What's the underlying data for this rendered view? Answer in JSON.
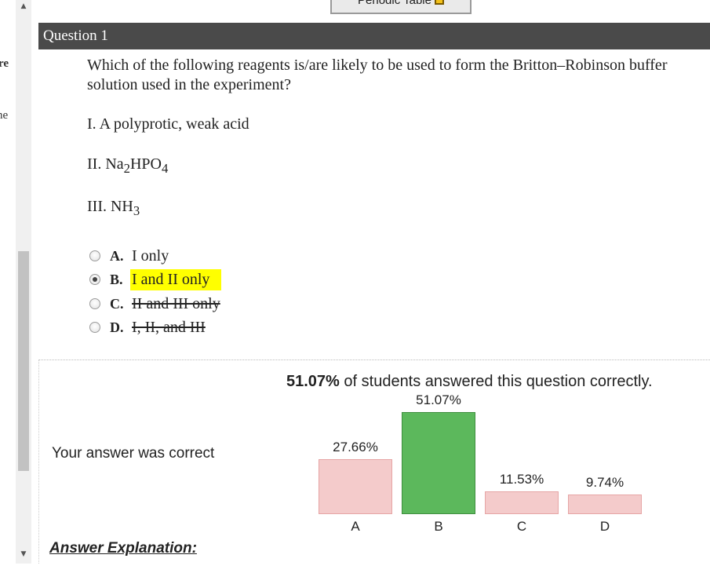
{
  "sidebar_fragments": [
    "re",
    "ne"
  ],
  "toolbar": {
    "periodic_table_label": "Periodic Table"
  },
  "question": {
    "header": "Question 1",
    "text": "Which of the following reagents is/are likely to be used to form the Britton–Robinson buffer solution used in the experiment?",
    "statements": [
      {
        "numeral": "I.",
        "text": "A polyprotic, weak acid"
      },
      {
        "numeral": "II.",
        "text": "Na",
        "sub1": "2",
        "mid": "HPO",
        "sub2": "4"
      },
      {
        "numeral": "III.",
        "text": "NH",
        "sub1": "3"
      }
    ],
    "choices": [
      {
        "letter": "A.",
        "text": "I only",
        "selected": false,
        "struck": false,
        "highlighted": false
      },
      {
        "letter": "B.",
        "text": "I and II only",
        "selected": true,
        "struck": false,
        "highlighted": true
      },
      {
        "letter": "C.",
        "text": "II and III only",
        "selected": false,
        "struck": true,
        "highlighted": false
      },
      {
        "letter": "D.",
        "text": "I, II, and III",
        "selected": false,
        "struck": true,
        "highlighted": false
      }
    ]
  },
  "results": {
    "correct_percent": "51.07%",
    "summary_suffix": " of students answered this question correctly.",
    "message": "Your answer was correct",
    "explanation_heading": "Answer Explanation:"
  },
  "colors": {
    "correct_bar": "#5cb85c",
    "other_bar": "#f4cbcb",
    "highlight": "#ffff00",
    "header_bg": "#4a4a4a"
  },
  "chart_data": {
    "type": "bar",
    "categories": [
      "A",
      "B",
      "C",
      "D"
    ],
    "values": [
      27.66,
      51.07,
      11.53,
      9.74
    ],
    "value_labels": [
      "27.66%",
      "51.07%",
      "11.53%",
      "9.74%"
    ],
    "correct_category": "B",
    "ylim": [
      0,
      51.07
    ]
  }
}
